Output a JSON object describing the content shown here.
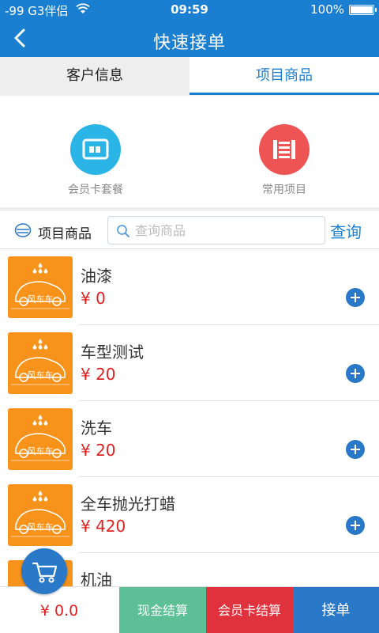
{
  "status_bar": {
    "carrier": "-99 G3伴侣",
    "time": "09:59",
    "battery": "100%",
    "battery_level": 1.0,
    "wifi_icon": "wifi-icon"
  },
  "nav": {
    "title": "快速接单",
    "back_icon": "chevron-left-icon"
  },
  "tabs": [
    {
      "label": "客户信息",
      "active": false
    },
    {
      "label": "项目商品",
      "active": true
    }
  ],
  "quick_actions": [
    {
      "label": "会员卡套餐",
      "icon": "card-icon",
      "color": "#2bb4e6"
    },
    {
      "label": "常用项目",
      "icon": "list-icon",
      "color": "#ef5454"
    }
  ],
  "search": {
    "category_label": "项目商品",
    "placeholder": "查询商品",
    "value": "",
    "button_label": "查询"
  },
  "products": [
    {
      "name": "油漆",
      "price": "¥ 0",
      "thumb_text": "风车车"
    },
    {
      "name": "车型测试",
      "price": "¥ 20",
      "thumb_text": "风车车"
    },
    {
      "name": "洗车",
      "price": "¥ 20",
      "thumb_text": "风车车"
    },
    {
      "name": "全车抛光打蜡",
      "price": "¥ 420",
      "thumb_text": "风车车"
    },
    {
      "name": "机油",
      "price": "",
      "thumb_text": "风车车"
    }
  ],
  "bottom_bar": {
    "total": "¥ 0.0",
    "cash_label": "现金结算",
    "member_label": "会员卡结算",
    "order_label": "接单"
  },
  "colors": {
    "primary": "#1a7fd0",
    "price": "#e02020",
    "cash": "#5cbf95",
    "member": "#e0323c",
    "thumb": "#f7931a"
  }
}
